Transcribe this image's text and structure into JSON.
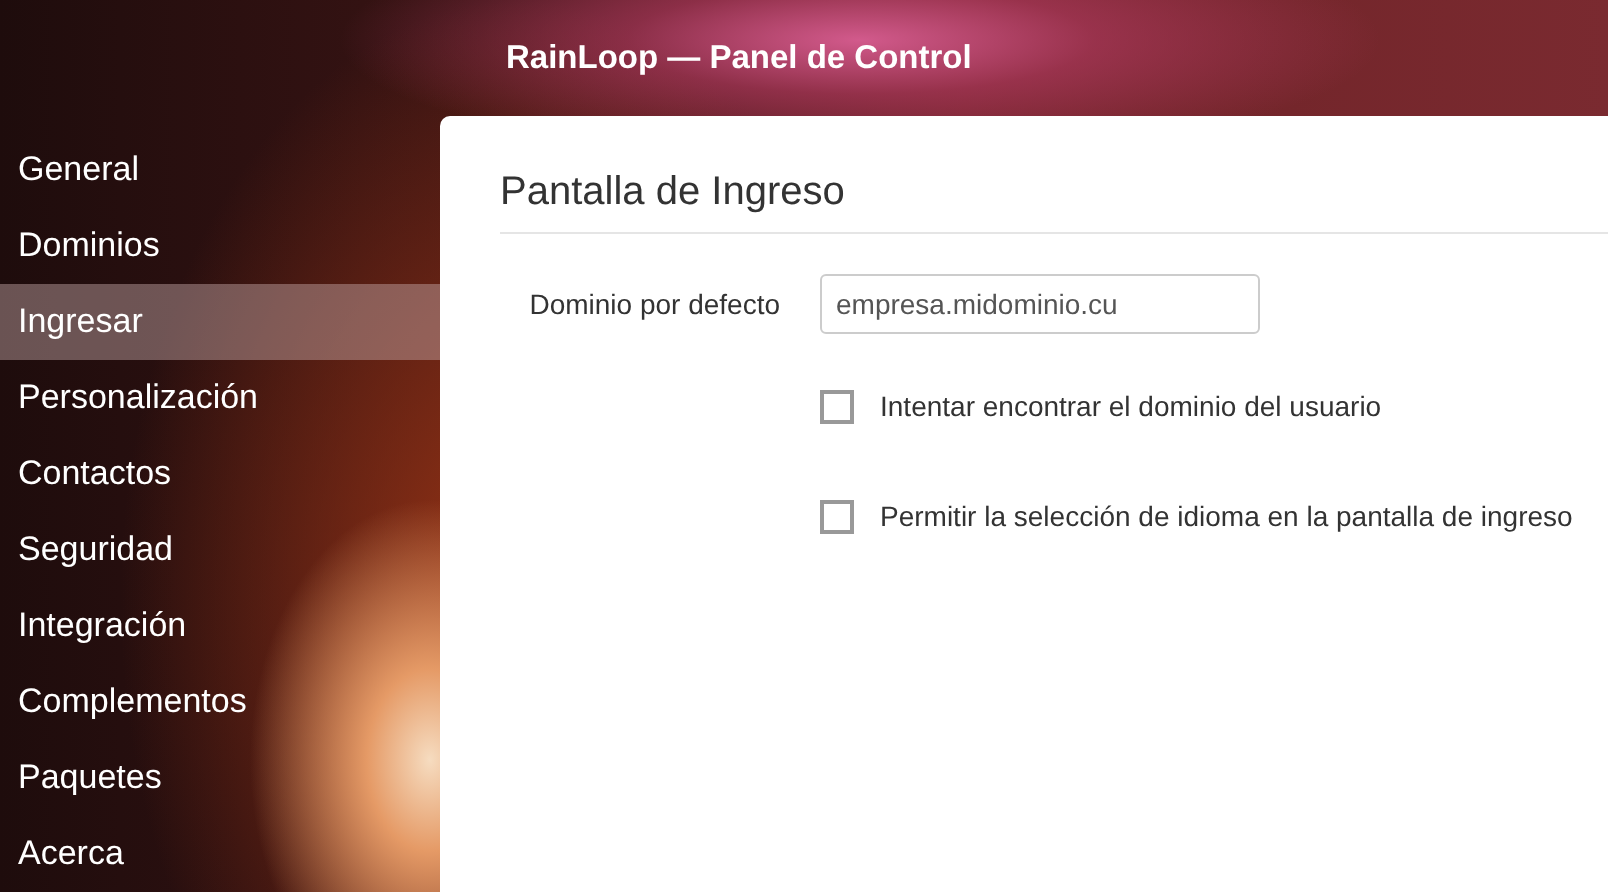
{
  "header": {
    "title": "RainLoop — Panel de Control"
  },
  "sidebar": {
    "items": [
      {
        "label": "General",
        "selected": false
      },
      {
        "label": "Dominios",
        "selected": false
      },
      {
        "label": "Ingresar",
        "selected": true
      },
      {
        "label": "Personalización",
        "selected": false
      },
      {
        "label": "Contactos",
        "selected": false
      },
      {
        "label": "Seguridad",
        "selected": false
      },
      {
        "label": "Integración",
        "selected": false
      },
      {
        "label": "Complementos",
        "selected": false
      },
      {
        "label": "Paquetes",
        "selected": false
      },
      {
        "label": "Acerca",
        "selected": false
      }
    ]
  },
  "panel": {
    "title": "Pantalla de Ingreso",
    "default_domain": {
      "label": "Dominio por defecto",
      "value": "empresa.midominio.cu"
    },
    "options": [
      {
        "label": "Intentar encontrar el dominio del usuario",
        "checked": false
      },
      {
        "label": "Permitir la selección de idioma en la pantalla de ingreso",
        "checked": false
      }
    ]
  }
}
